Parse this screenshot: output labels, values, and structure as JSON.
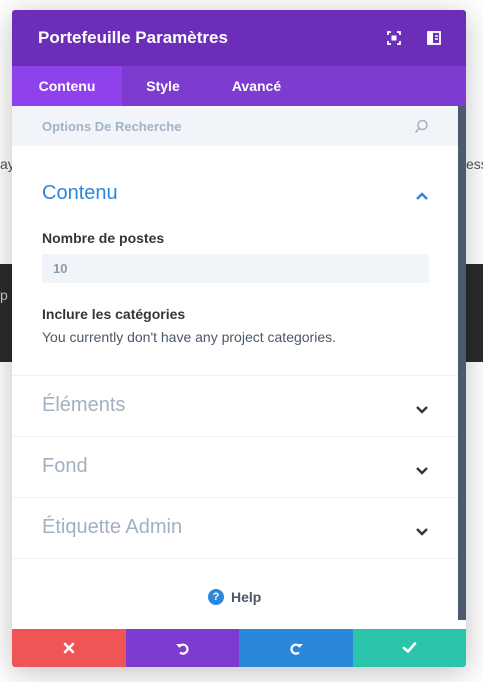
{
  "background": {
    "left_fragment": "ay",
    "right_fragment": "essu",
    "dark_fragment": "p"
  },
  "modal": {
    "title": "Portefeuille Paramètres",
    "header_icons": [
      "fullscreen-icon",
      "sidebar-layout-icon"
    ],
    "tabs": [
      {
        "label": "Contenu",
        "active": true
      },
      {
        "label": "Style",
        "active": false
      },
      {
        "label": "Avancé",
        "active": false
      }
    ]
  },
  "search": {
    "placeholder": "Options De Recherche",
    "icon": "search-icon"
  },
  "content_toggle": {
    "title": "Contenu",
    "posts_label": "Nombre de postes",
    "posts_value": "10",
    "categories_label": "Inclure les catégories",
    "categories_info": "You currently don't have any project categories."
  },
  "toggles": [
    {
      "title": "Éléments"
    },
    {
      "title": "Fond"
    },
    {
      "title": "Étiquette Admin"
    }
  ],
  "help": {
    "label": "Help",
    "icon_glyph": "?"
  },
  "footer": {
    "buttons": [
      {
        "name": "discard-button",
        "icon": "close-icon",
        "color": "#ef5555"
      },
      {
        "name": "undo-button",
        "icon": "undo-icon",
        "color": "#7d3bcf"
      },
      {
        "name": "redo-button",
        "icon": "redo-icon",
        "color": "#2b87da"
      },
      {
        "name": "save-button",
        "icon": "check-icon",
        "color": "#29c4a9"
      }
    ]
  },
  "colors": {
    "header": "#6c2eb9",
    "tabs": "#7d3bcf",
    "active_tab": "#8f42ec",
    "accent_blue": "#2b87da"
  }
}
